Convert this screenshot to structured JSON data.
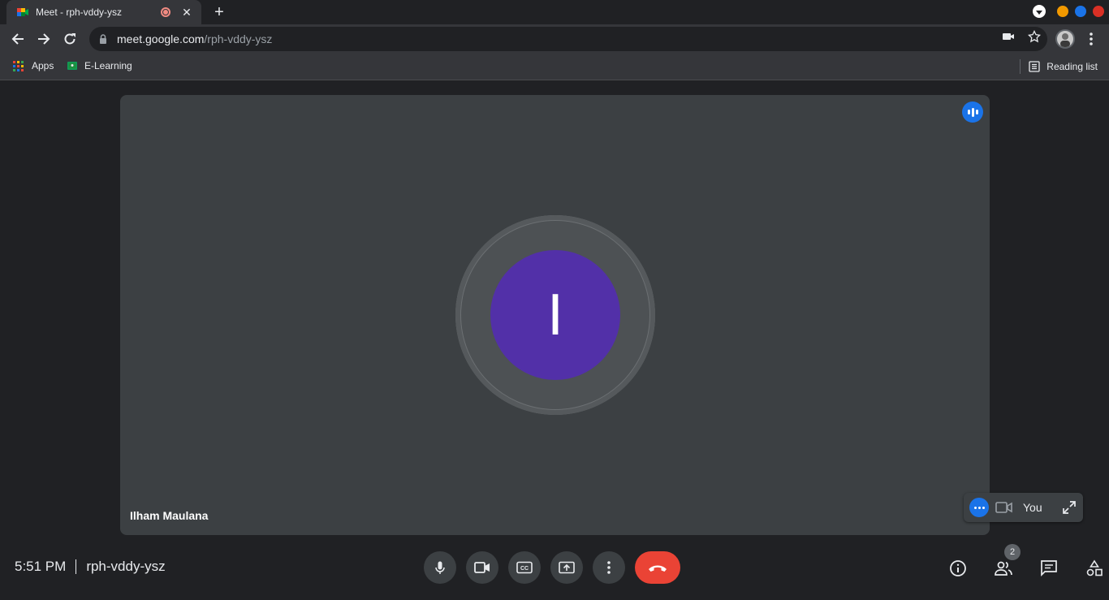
{
  "browser": {
    "tab": {
      "title": "Meet - rph-vddy-ysz",
      "close_label": "✕",
      "favicon": "google-meet-icon"
    },
    "new_tab_label": "+",
    "window_dots": {
      "colors": [
        "#f29900",
        "#1a73e8",
        "#d93025"
      ]
    },
    "url": {
      "host": "meet.google.com",
      "path": "/rph-vddy-ysz"
    },
    "bookmarks": [
      {
        "label": "Apps",
        "icon": "apps-grid-icon"
      },
      {
        "label": "E-Learning",
        "icon": "classroom-icon"
      }
    ],
    "reading_list_label": "Reading list"
  },
  "meet": {
    "participant": {
      "name": "Ilham Maulana",
      "initial": "I",
      "avatar_color": "#5230a8"
    },
    "self_tile": {
      "label": "You"
    },
    "clock": "5:51 PM",
    "meeting_code": "rph-vddy-ysz",
    "participants_count": "2",
    "controls": [
      "mic-icon",
      "camera-icon",
      "captions-icon",
      "present-icon",
      "more-options-icon",
      "hang-up-icon"
    ],
    "right_controls": [
      "info-icon",
      "people-icon",
      "chat-icon",
      "activities-icon"
    ],
    "colors": {
      "accent": "#1a73e8",
      "end_call": "#ea4335",
      "tile": "#3c4043",
      "background": "#202124"
    }
  }
}
